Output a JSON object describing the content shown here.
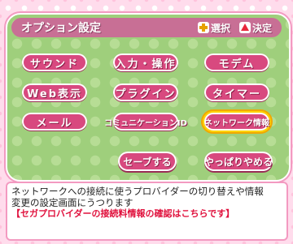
{
  "header": {
    "title": "オプション設定",
    "select_hint": "選択",
    "confirm_hint": "決定",
    "select_icon": "plus-dpad-icon",
    "confirm_icon": "triangle-button-icon"
  },
  "options": [
    {
      "label": "サウンド"
    },
    {
      "label": "入力・操作"
    },
    {
      "label": "モデム"
    },
    {
      "label": "Web表示"
    },
    {
      "label": "プラグイン"
    },
    {
      "label": "タイマー"
    },
    {
      "label": "メール"
    },
    {
      "label": "コミュニケーションID"
    },
    {
      "label": "ネットワーク情報",
      "selected": true
    }
  ],
  "actions": {
    "save": "セーブする",
    "cancel": "やっぱりやめる"
  },
  "description": {
    "line1": "ネットワークへの接続に使うプロバイダーの切り替えや情報",
    "line2": "変更の設定画面にうつります",
    "line3": "【セガプロバイダーの接続料情報の確認はこちらです】"
  },
  "colors": {
    "panel": "#9fcf7c",
    "button": "#d8497f",
    "title_bar": "#c86f95",
    "highlight": "#ffd400",
    "note_red": "#e0103c"
  }
}
